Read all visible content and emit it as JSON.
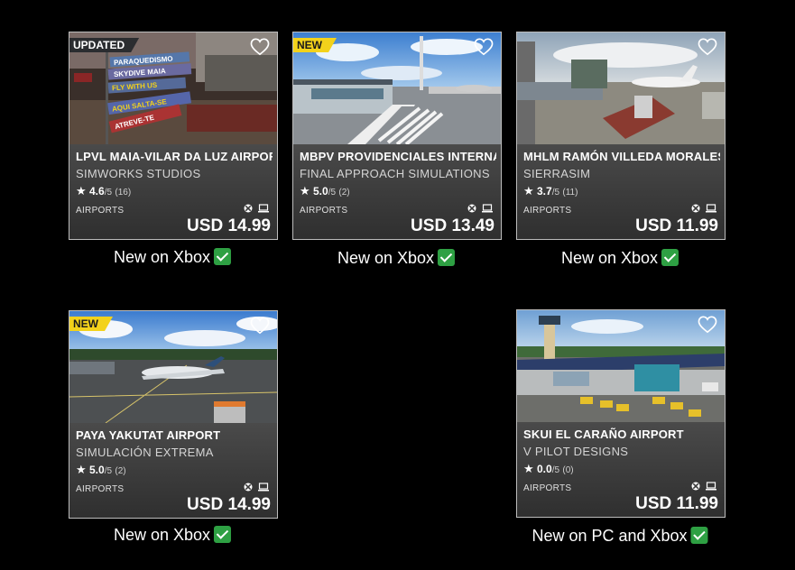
{
  "cards": [
    {
      "title": "LPVL MAIA-VILAR DA LUZ AIRPORT",
      "publisher": "SIMWORKS STUDIOS",
      "rating": "4.6",
      "rating_outof": "/5",
      "rating_count": "(16)",
      "category": "AIRPORTS",
      "price": "USD 14.99",
      "badge": "UPDATED",
      "caption": "New on Xbox",
      "signs": [
        "PARAQUEDISMO",
        "SKYDIVE MAIA",
        "FLY WITH US",
        "AQUI SALTA-SE",
        "ATREVE-TE"
      ]
    },
    {
      "title": "MBPV PROVIDENCIALES INTERNAT",
      "publisher": "FINAL APPROACH SIMULATIONS",
      "rating": "5.0",
      "rating_outof": "/5",
      "rating_count": "(2)",
      "category": "AIRPORTS",
      "price": "USD 13.49",
      "badge": "NEW",
      "caption": "New on Xbox"
    },
    {
      "title": "MHLM RAMÓN VILLEDA MORALES I",
      "publisher": "SIERRASIM",
      "rating": "3.7",
      "rating_outof": "/5",
      "rating_count": "(11)",
      "category": "AIRPORTS",
      "price": "USD 11.99",
      "badge": "",
      "caption": "New on Xbox"
    },
    {
      "title": "PAYA YAKUTAT AIRPORT",
      "publisher": "SIMULACIÓN EXTREMA",
      "rating": "5.0",
      "rating_outof": "/5",
      "rating_count": "(2)",
      "category": "AIRPORTS",
      "price": "USD 14.99",
      "badge": "NEW",
      "caption": "New on Xbox"
    },
    {
      "title": "SKUI EL CARAÑO AIRPORT",
      "publisher": "V PILOT DESIGNS",
      "rating": "0.0",
      "rating_outof": "/5",
      "rating_count": "(0)",
      "category": "AIRPORTS",
      "price": "USD 11.99",
      "badge": "",
      "caption": "New on PC and Xbox"
    }
  ],
  "icons": {
    "star": "star-icon",
    "heart": "heart-icon",
    "xbox": "xbox-icon",
    "pc": "pc-icon",
    "check": "checkmark-icon"
  },
  "colors": {
    "new_badge": "#f3d21b",
    "updated_badge": "#2b2d30",
    "check": "#2ea043",
    "background": "#000000"
  }
}
